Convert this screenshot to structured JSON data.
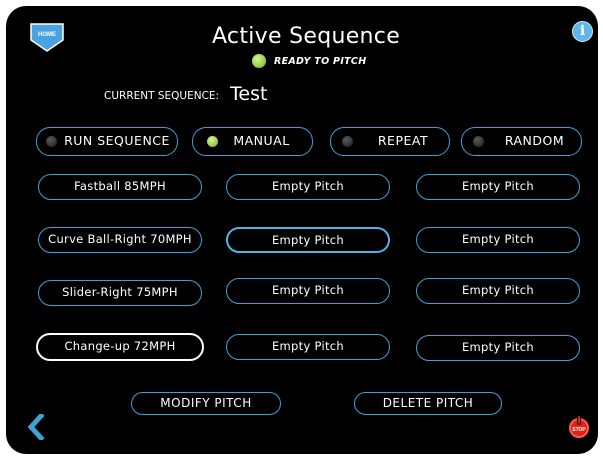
{
  "header": {
    "home_label": "HOME",
    "title": "Active Sequence",
    "status": "READY TO PITCH"
  },
  "sequence": {
    "label": "CURRENT SEQUENCE:",
    "value": "Test"
  },
  "modes": [
    {
      "label": "RUN SEQUENCE",
      "active": false
    },
    {
      "label": "MANUAL",
      "active": true
    },
    {
      "label": "REPEAT",
      "active": false
    },
    {
      "label": "RANDOM",
      "active": false
    }
  ],
  "pitches": [
    [
      "Fastball 85MPH",
      "Empty Pitch",
      "Empty Pitch"
    ],
    [
      "Curve Ball-Right 70MPH",
      "Empty Pitch",
      "Empty Pitch"
    ],
    [
      "Slider-Right 75MPH",
      "Empty Pitch",
      "Empty Pitch"
    ],
    [
      "Change-up 72MPH",
      "Empty Pitch",
      "Empty Pitch"
    ]
  ],
  "actions": {
    "modify": "MODIFY PITCH",
    "delete": "DELETE PITCH"
  },
  "footer": {
    "stop_label": "STOP"
  },
  "colors": {
    "background": "#000000",
    "accent": "#3ba3d6",
    "status_green": "#9fd34e",
    "stop_red": "#d9231c",
    "home_blue": "#4aa3e0"
  }
}
